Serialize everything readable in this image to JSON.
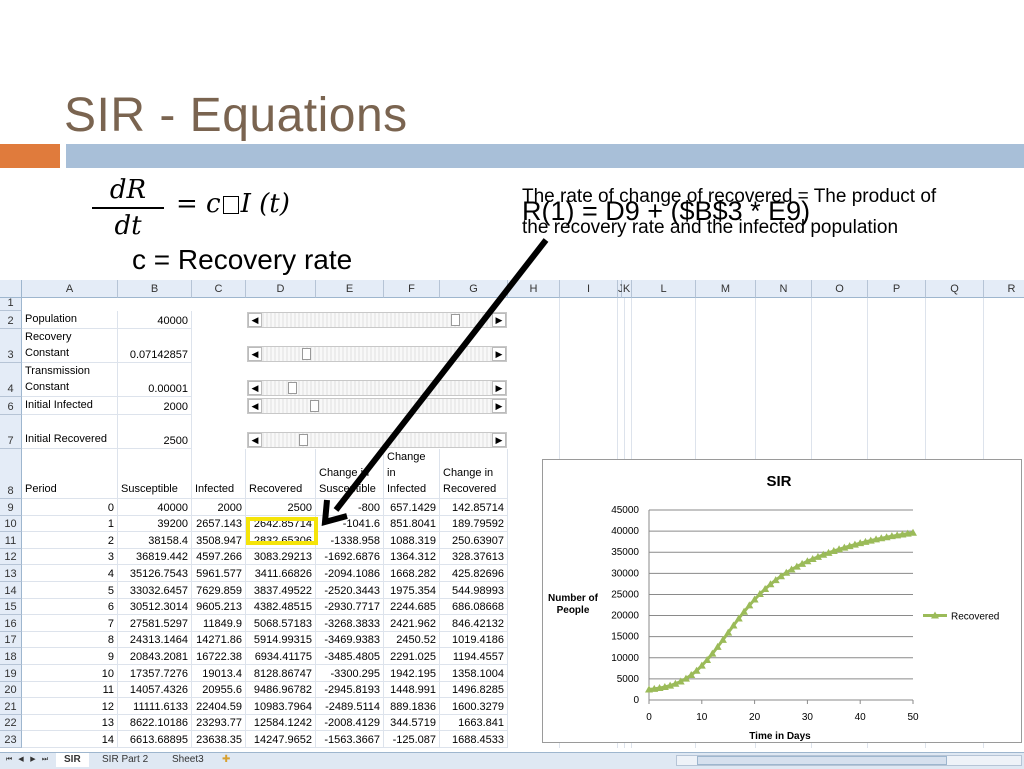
{
  "slide": {
    "title": "SIR - Equations",
    "eq_num": "dR",
    "eq_den": "dt",
    "eq_rhs_left": "= c",
    "eq_rhs_right": "I (t)",
    "recovery_label": "c = Recovery rate",
    "note": "The rate of change of recovered = The product of the recovery rate and the infected population",
    "formula": "R(1) = D9 + ($B$3 * E9)"
  },
  "sheet": {
    "columns": [
      "A",
      "B",
      "C",
      "D",
      "E",
      "F",
      "G",
      "H",
      "I",
      "J",
      "K",
      "L",
      "M",
      "N",
      "O",
      "P",
      "Q",
      "R"
    ],
    "params": [
      {
        "row": "2",
        "label": "Population",
        "value": "40000"
      },
      {
        "row": "3",
        "label": "Recovery Constant",
        "value": "0.07142857"
      },
      {
        "row": "4",
        "label": "Transmission Constant",
        "value": "0.00001"
      },
      {
        "row": "6",
        "label": "Initial Infected",
        "value": "2000"
      },
      {
        "row": "7",
        "label": "Initial Recovered",
        "value": "2500"
      }
    ],
    "empty_rows": [
      "1",
      "5"
    ],
    "headers": {
      "row": "8",
      "period": "Period",
      "susceptible": "Susceptible",
      "infected": "Infected",
      "recovered": "Recovered",
      "chg_s": "Change in Susceptible",
      "chg_i": "Change in Infected",
      "chg_r": "Change in Recovered"
    },
    "rows": [
      [
        "9",
        "0",
        "40000",
        "2000",
        "2500",
        "-800",
        "657.1429",
        "142.85714"
      ],
      [
        "10",
        "1",
        "39200",
        "2657.143",
        "2642.85714",
        "-1041.6",
        "851.8041",
        "189.79592"
      ],
      [
        "11",
        "2",
        "38158.4",
        "3508.947",
        "2832.65306",
        "-1338.958",
        "1088.319",
        "250.63907"
      ],
      [
        "12",
        "3",
        "36819.442",
        "4597.266",
        "3083.29213",
        "-1692.6876",
        "1364.312",
        "328.37613"
      ],
      [
        "13",
        "4",
        "35126.7543",
        "5961.577",
        "3411.66826",
        "-2094.1086",
        "1668.282",
        "425.82696"
      ],
      [
        "14",
        "5",
        "33032.6457",
        "7629.859",
        "3837.49522",
        "-2520.3443",
        "1975.354",
        "544.98993"
      ],
      [
        "15",
        "6",
        "30512.3014",
        "9605.213",
        "4382.48515",
        "-2930.7717",
        "2244.685",
        "686.08668"
      ],
      [
        "16",
        "7",
        "27581.5297",
        "11849.9",
        "5068.57183",
        "-3268.3833",
        "2421.962",
        "846.42132"
      ],
      [
        "17",
        "8",
        "24313.1464",
        "14271.86",
        "5914.99315",
        "-3469.9383",
        "2450.52",
        "1019.4186"
      ],
      [
        "18",
        "9",
        "20843.2081",
        "16722.38",
        "6934.41175",
        "-3485.4805",
        "2291.025",
        "1194.4557"
      ],
      [
        "19",
        "10",
        "17357.7276",
        "19013.4",
        "8128.86747",
        "-3300.295",
        "1942.195",
        "1358.1004"
      ],
      [
        "20",
        "11",
        "14057.4326",
        "20955.6",
        "9486.96782",
        "-2945.8193",
        "1448.991",
        "1496.8285"
      ],
      [
        "21",
        "12",
        "11111.6133",
        "22404.59",
        "10983.7964",
        "-2489.5114",
        "889.1836",
        "1600.3279"
      ],
      [
        "22",
        "13",
        "8622.10186",
        "23293.77",
        "12584.1242",
        "-2008.4129",
        "344.5719",
        "1663.841"
      ],
      [
        "23",
        "14",
        "6613.68895",
        "23638.35",
        "14247.9652",
        "-1563.3667",
        "-125.087",
        "1688.4533"
      ]
    ]
  },
  "tabs": {
    "sheets": [
      "SIR",
      "SIR Part 2",
      "Sheet3"
    ],
    "active": "SIR"
  },
  "chart_data": {
    "type": "line",
    "title": "SIR",
    "xlabel": "Time in Days",
    "ylabel": "Number of People",
    "xlim": [
      0,
      50
    ],
    "ylim": [
      0,
      45000
    ],
    "xticks": [
      "0",
      "10",
      "20",
      "30",
      "40",
      "50"
    ],
    "yticks": [
      "0",
      "5000",
      "10000",
      "15000",
      "20000",
      "25000",
      "30000",
      "35000",
      "40000",
      "45000"
    ],
    "grid": true,
    "legend_position": "right",
    "series": [
      {
        "name": "Recovered",
        "color": "#9bbb59",
        "x": [
          0,
          1,
          2,
          3,
          4,
          5,
          6,
          7,
          8,
          9,
          10,
          11,
          12,
          13,
          14,
          15,
          16,
          17,
          18,
          19,
          20,
          21,
          22,
          23,
          24,
          25,
          26,
          27,
          28,
          29,
          30,
          31,
          32,
          33,
          34,
          35,
          36,
          37,
          38,
          39,
          40,
          41,
          42,
          43,
          44,
          45,
          46,
          47,
          48,
          49,
          50
        ],
        "y": [
          2500,
          2643,
          2833,
          3083,
          3412,
          3837,
          4382,
          5069,
          5915,
          6934,
          8129,
          9487,
          10984,
          12584,
          14248,
          15950,
          17650,
          19300,
          20900,
          22400,
          23800,
          25100,
          26300,
          27400,
          28400,
          29300,
          30150,
          30900,
          31600,
          32250,
          32850,
          33400,
          33900,
          34400,
          34850,
          35300,
          35700,
          36100,
          36450,
          36800,
          37150,
          37450,
          37750,
          38050,
          38300,
          38550,
          38800,
          39000,
          39200,
          39400,
          39600
        ]
      }
    ]
  }
}
